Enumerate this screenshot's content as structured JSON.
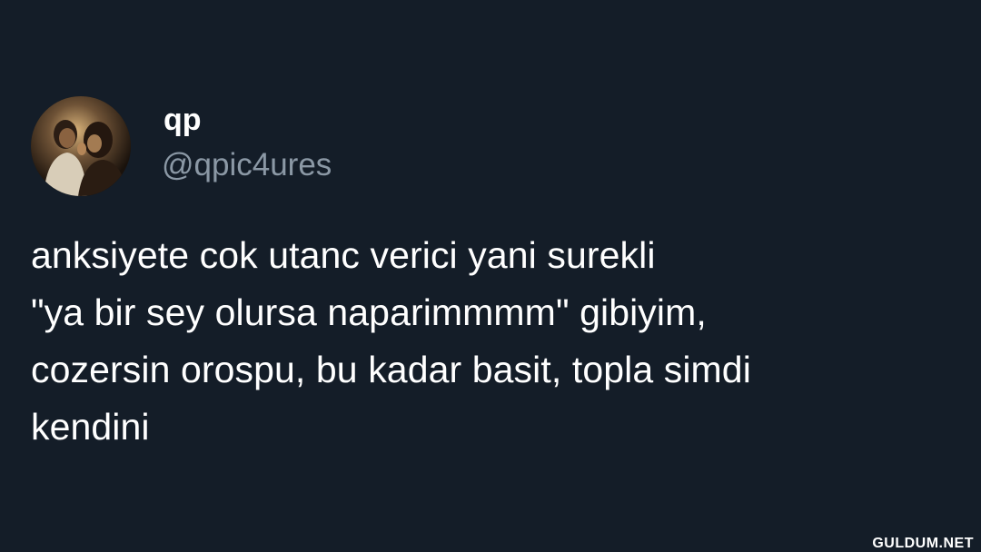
{
  "tweet": {
    "display_name": "qp",
    "handle": "@qpic4ures",
    "text": "anksiyete cok utanc verici yani surekli\n\"ya bir sey olursa naparimmmm\" gibiyim,\ncozersin orospu, bu kadar basit, topla simdi\nkendini"
  },
  "watermark": "GULDUM.NET",
  "colors": {
    "background": "#141d28",
    "text": "#ffffff",
    "handle": "#8b98a5"
  }
}
